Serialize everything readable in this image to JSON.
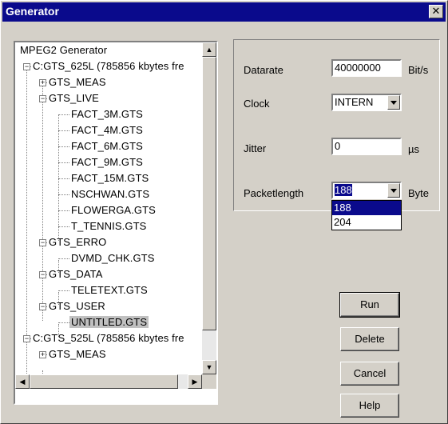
{
  "window": {
    "title": "Generator"
  },
  "tree": {
    "nodes": [
      {
        "label": "MPEG2 Generator"
      },
      {
        "label": "C:GTS_625L (785856 kbytes fre"
      },
      {
        "label": "GTS_MEAS"
      },
      {
        "label": "GTS_LIVE"
      },
      {
        "label": "FACT_3M.GTS"
      },
      {
        "label": "FACT_4M.GTS"
      },
      {
        "label": "FACT_6M.GTS"
      },
      {
        "label": "FACT_9M.GTS"
      },
      {
        "label": "FACT_15M.GTS"
      },
      {
        "label": "NSCHWAN.GTS"
      },
      {
        "label": "FLOWERGA.GTS"
      },
      {
        "label": "T_TENNIS.GTS"
      },
      {
        "label": "GTS_ERRO"
      },
      {
        "label": "DVMD_CHK.GTS"
      },
      {
        "label": "GTS_DATA"
      },
      {
        "label": "TELETEXT.GTS"
      },
      {
        "label": "GTS_USER"
      },
      {
        "label": "UNTITLED.GTS"
      },
      {
        "label": "C:GTS_525L (785856 kbytes fre"
      },
      {
        "label": "GTS_MEAS"
      }
    ]
  },
  "settings": {
    "datarate": {
      "label": "Datarate",
      "value": "40000000",
      "unit": "Bit/s"
    },
    "clock": {
      "label": "Clock",
      "value": "INTERN"
    },
    "jitter": {
      "label": "Jitter",
      "value": "0",
      "unit": "µs"
    },
    "packetlength": {
      "label": "Packetlength",
      "value": "188",
      "unit": "Byte",
      "options": [
        "188",
        "204"
      ]
    }
  },
  "buttons": {
    "run": "Run",
    "delete": "Delete",
    "cancel": "Cancel",
    "help": "Help"
  }
}
